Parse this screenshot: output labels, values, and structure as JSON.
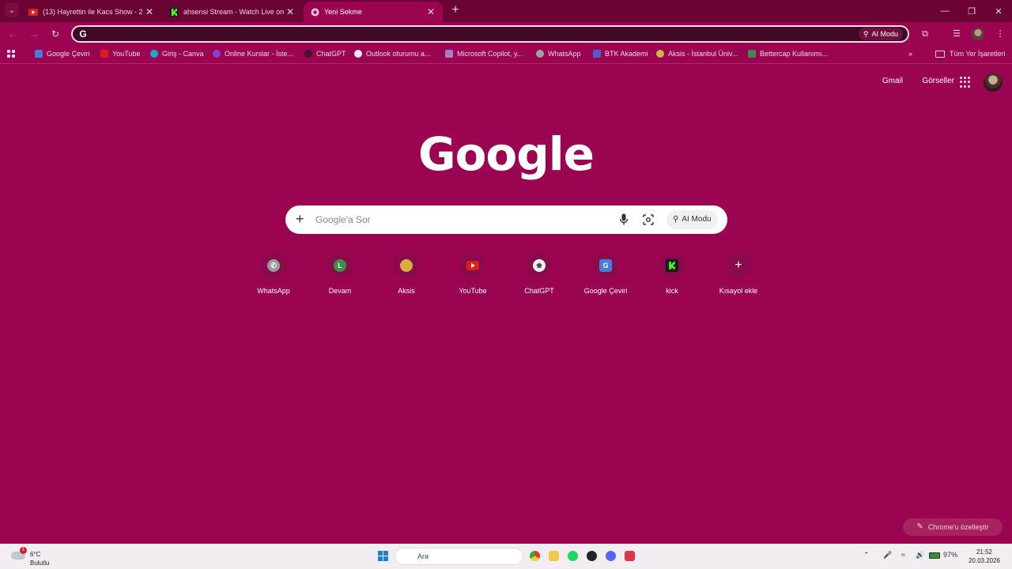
{
  "tabs": [
    {
      "title": "(13) Hayrettin ile Kacs Show - 2",
      "favicon": "youtube-icon",
      "active": false
    },
    {
      "title": "ahsensi Stream - Watch Live on",
      "favicon": "kick-icon",
      "active": false
    },
    {
      "title": "Yeni Sekme",
      "favicon": "chrome-icon",
      "active": true
    }
  ],
  "omnibox": {
    "value": "",
    "ai_mode_label": "AI Modu"
  },
  "bookmarks": [
    {
      "label": "Google Çeviri",
      "icon": "google-translate-icon",
      "color": "#4a7bd6"
    },
    {
      "label": "YouTube",
      "icon": "youtube-icon",
      "color": "#e01d1d"
    },
    {
      "label": "Giriş - Canva",
      "icon": "canva-icon",
      "color": "#27a3c7"
    },
    {
      "label": "Online Kurslar - İste...",
      "icon": "udemy-icon",
      "color": "#8a3fd1"
    },
    {
      "label": "ChatGPT",
      "icon": "chatgpt-icon",
      "color": "#3a1a2a"
    },
    {
      "label": "Outlook oturumu a...",
      "icon": "outlook-icon",
      "color": "#e8e8e8"
    },
    {
      "label": "Microsoft Copilot, y...",
      "icon": "copilot-icon",
      "color": "#6a8ee8"
    },
    {
      "label": "WhatsApp",
      "icon": "whatsapp-icon",
      "color": "#a0a0a0"
    },
    {
      "label": "BTK Akademi",
      "icon": "btk-icon",
      "color": "#4a62c8"
    },
    {
      "label": "Aksis - İstanbul Üniv...",
      "icon": "aksis-icon",
      "color": "#d8b040"
    },
    {
      "label": "Bettercap Kullanımı...",
      "icon": "bettercap-icon",
      "color": "#3a8a5a"
    }
  ],
  "all_bookmarks_label": "Tüm Yer İşaretleri",
  "top_links": {
    "gmail": "Gmail",
    "images": "Görseller"
  },
  "logo_text": "Google",
  "search": {
    "placeholder": "Google'a Sor",
    "ai_mode_label": "AI Modu"
  },
  "shortcuts": [
    {
      "label": "WhatsApp",
      "icon": "whatsapp-icon"
    },
    {
      "label": "Devam",
      "icon": "devam-icon",
      "letter": "L"
    },
    {
      "label": "Aksis",
      "icon": "aksis-icon"
    },
    {
      "label": "YouTube",
      "icon": "youtube-icon"
    },
    {
      "label": "ChatGPT",
      "icon": "chatgpt-icon"
    },
    {
      "label": "Google Çeviri",
      "icon": "google-translate-icon"
    },
    {
      "label": "kick",
      "icon": "kick-icon"
    },
    {
      "label": "Kısayol ekle",
      "icon": "add-icon"
    }
  ],
  "customize_label": "Chrome'u özelleştir",
  "taskbar": {
    "weather_temp": "6°C",
    "weather_cond": "Bulutlu",
    "weather_badge": "1",
    "search_placeholder": "Ara",
    "battery": "97%",
    "time": "21:52",
    "date": "20.03.2026"
  },
  "colors": {
    "background": "#9a0451",
    "tabstrip": "#6b0335",
    "omnibox": "#3e0a26"
  }
}
